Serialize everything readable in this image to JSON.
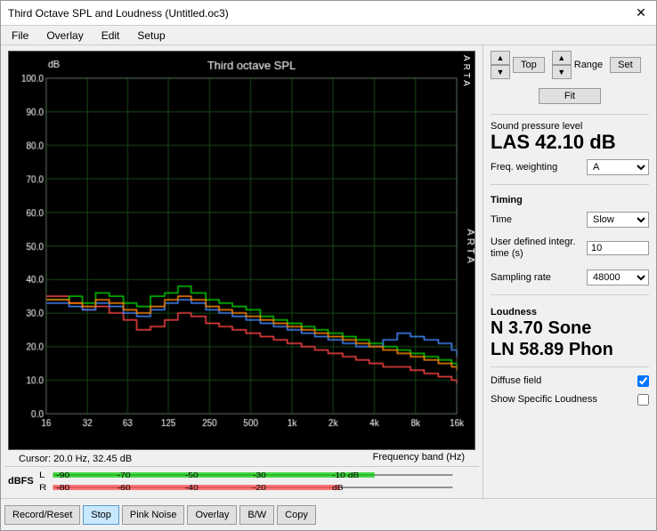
{
  "window": {
    "title": "Third Octave SPL and Loudness (Untitled.oc3)"
  },
  "menu": {
    "items": [
      "File",
      "Overlay",
      "Edit",
      "Setup"
    ]
  },
  "chart": {
    "title": "Third octave SPL",
    "y_label": "dB",
    "cursor_info": "Cursor:  20.0 Hz, 32.45 dB",
    "freq_label": "Frequency band (Hz)",
    "x_ticks": [
      "16",
      "32",
      "63",
      "125",
      "250",
      "500",
      "1k",
      "2k",
      "4k",
      "8k",
      "16k"
    ],
    "y_ticks": [
      "100.0",
      "90.0",
      "80.0",
      "70.0",
      "60.0",
      "50.0",
      "40.0",
      "30.0",
      "20.0",
      "10.0"
    ],
    "arta": "ARTA"
  },
  "controls": {
    "top_label": "Top",
    "range_label": "Range",
    "fit_label": "Fit",
    "set_label": "Set"
  },
  "spl": {
    "header": "Sound pressure level",
    "value": "LAS 42.10 dB",
    "freq_weighting_label": "Freq. weighting",
    "freq_weighting_value": "A"
  },
  "timing": {
    "header": "Timing",
    "time_label": "Time",
    "time_value": "Slow",
    "user_defined_label": "User defined integr. time (s)",
    "user_defined_value": "10",
    "sampling_rate_label": "Sampling rate",
    "sampling_rate_value": "48000"
  },
  "loudness": {
    "header": "Loudness",
    "value_line1": "N 3.70 Sone",
    "value_line2": "LN 58.89 Phon",
    "diffuse_field_label": "Diffuse field",
    "diffuse_field_checked": true,
    "show_specific_label": "Show Specific Loudness",
    "show_specific_checked": false
  },
  "dbfs": {
    "label": "dBFS",
    "top_scale": [
      "-90",
      "-70",
      "-50",
      "-30",
      "-10 dB"
    ],
    "bottom_scale": [
      "-80",
      "-60",
      "-40",
      "-20",
      "dB"
    ],
    "top_color": "#00cc00",
    "bottom_color": "#ff4444"
  },
  "buttons": {
    "record_reset": "Record/Reset",
    "stop": "Stop",
    "pink_noise": "Pink Noise",
    "overlay": "Overlay",
    "bw": "B/W",
    "copy": "Copy"
  }
}
